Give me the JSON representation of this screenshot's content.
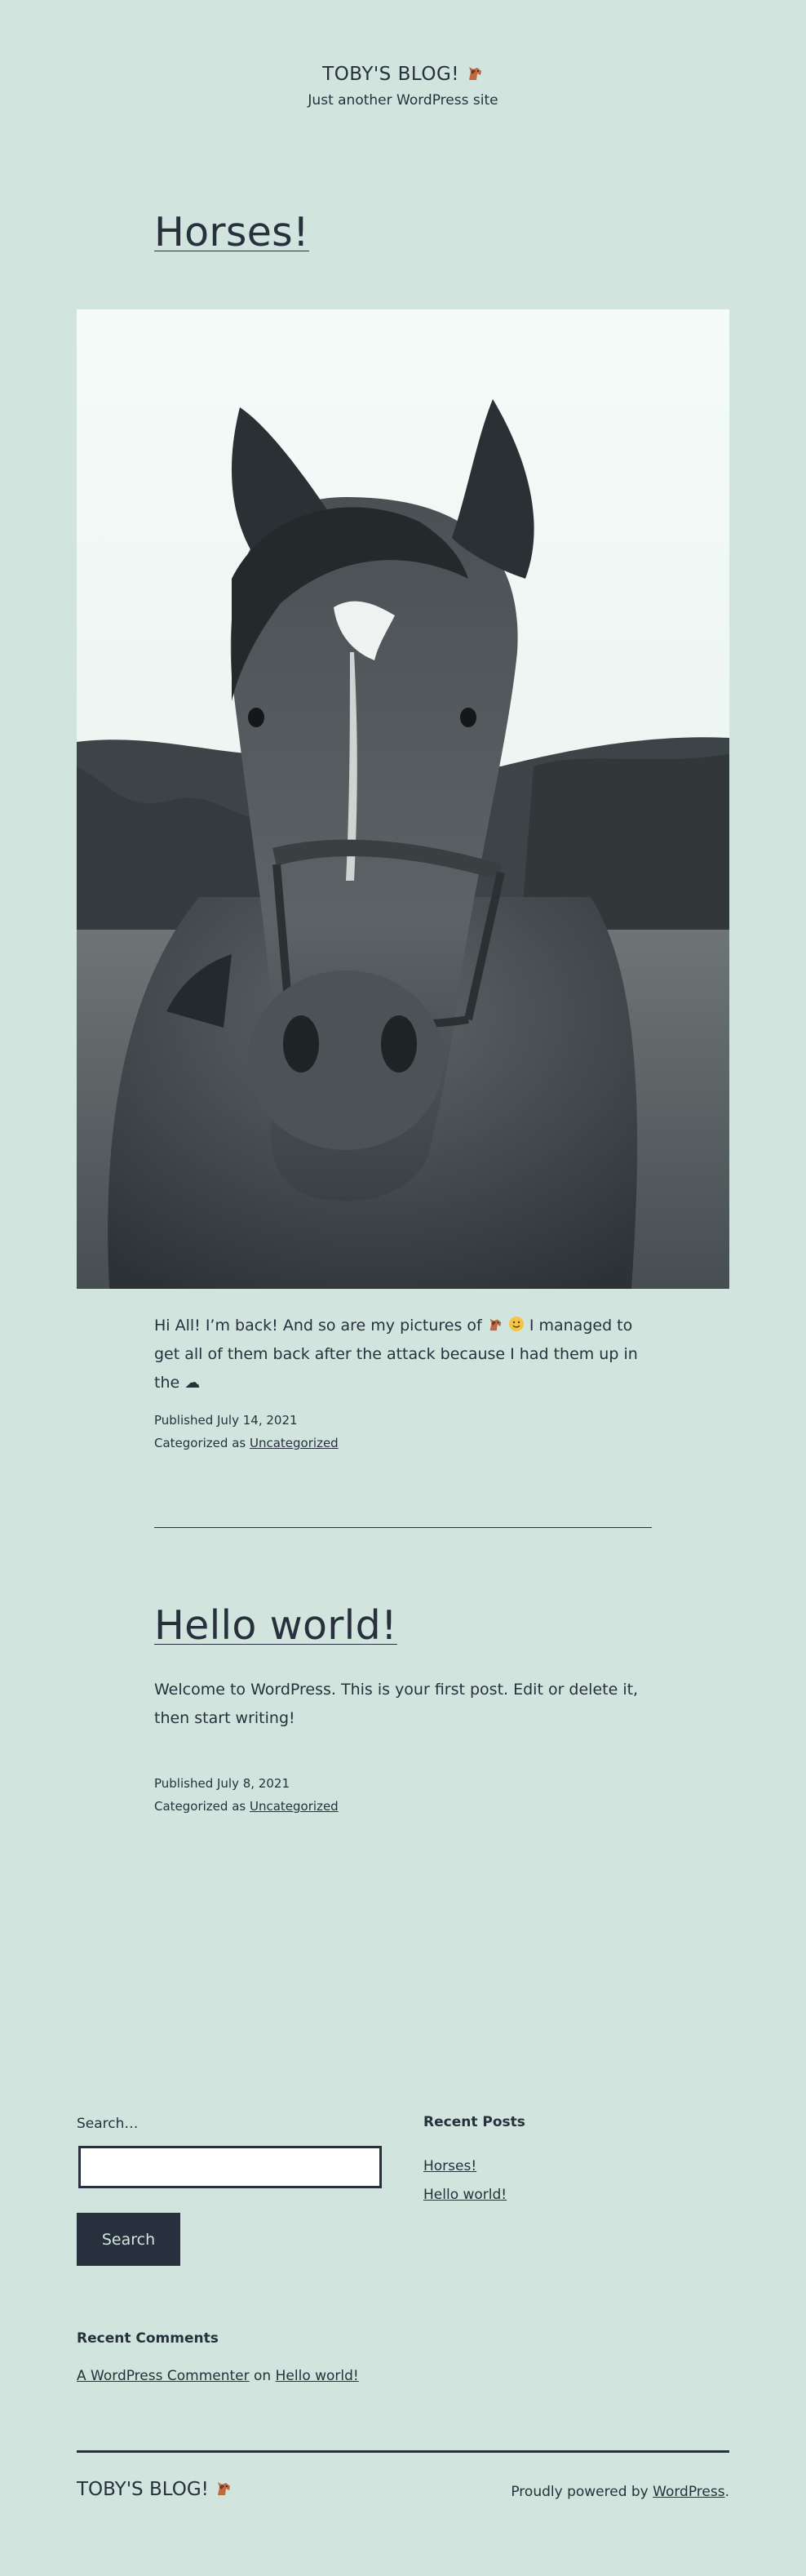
{
  "site": {
    "title": "TOBY'S BLOG!",
    "tagline": "Just another WordPress site"
  },
  "posts": [
    {
      "title": "Horses!",
      "content_before_emoji": "Hi All! I’m back! And so are my pictures of",
      "content_after_emoji": "I managed to get all of them back after the attack because I had them up in the ☁",
      "published": "Published July 14, 2021",
      "categorized_prefix": "Categorized as",
      "category": "Uncategorized"
    },
    {
      "title": "Hello world!",
      "content": "Welcome to WordPress. This is your first post. Edit or delete it, then start writing!",
      "published": "Published July 8, 2021",
      "categorized_prefix": "Categorized as",
      "category": "Uncategorized"
    }
  ],
  "search": {
    "label": "Search…",
    "button_label": "Search",
    "value": ""
  },
  "recent_posts": {
    "heading": "Recent Posts",
    "items": [
      "Horses!",
      "Hello world!"
    ]
  },
  "recent_comments": {
    "heading": "Recent Comments",
    "author": "A WordPress Commenter",
    "on": "on",
    "post": "Hello world!"
  },
  "footer": {
    "title": "TOBY'S BLOG!",
    "powered_prefix": "Proudly powered by",
    "powered_link": "WordPress",
    "powered_suffix": "."
  },
  "icons": [
    "horse-emoji-icon",
    "smile-emoji-icon"
  ],
  "colors": {
    "background": "#d1e4dd",
    "text": "#28303d"
  }
}
